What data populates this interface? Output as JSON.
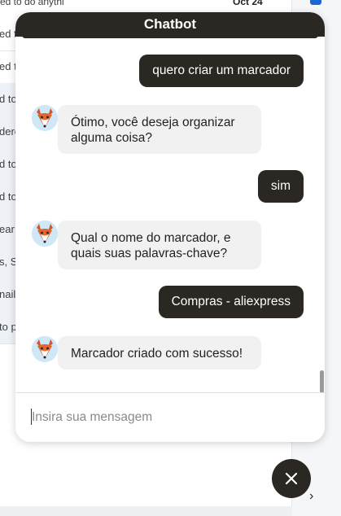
{
  "background": {
    "first_row": {
      "snippet": "ed to do anythi",
      "date": "Oct 24"
    },
    "rows": [
      {
        "text": "ed t",
        "shaded": false
      },
      {
        "text": "ed t",
        "shaded": false
      },
      {
        "text": "d to",
        "shaded": true
      },
      {
        "text": "dere",
        "shaded": true
      },
      {
        "text": "d to",
        "shaded": true
      },
      {
        "text": "d to",
        "shaded": true
      },
      {
        "text": "ear",
        "shaded": true
      },
      {
        "text": "s, S",
        "shaded": true
      },
      {
        "text": "nail",
        "shaded": true
      },
      {
        "text": "to p",
        "shaded": true
      }
    ]
  },
  "chat": {
    "title": "Chatbot",
    "messages": [
      {
        "role": "user",
        "text": "quero criar um marcador"
      },
      {
        "role": "bot",
        "text": "Ótimo, você deseja organizar alguma coisa?"
      },
      {
        "role": "user",
        "text": "sim"
      },
      {
        "role": "bot",
        "text": "Qual o nome do marcador, e quais suas palavras-chave?"
      },
      {
        "role": "user",
        "text": "Compras - aliexpress"
      },
      {
        "role": "bot",
        "text": "Marcador criado com sucesso!"
      }
    ],
    "input": {
      "placeholder": "Insira sua mensagem",
      "value": ""
    }
  },
  "icons": {
    "avatar": "fox-avatar-icon",
    "close": "close-icon",
    "rail": "chevron-right-icon"
  },
  "colors": {
    "header_bg": "#2b2823",
    "user_bubble": "#2b2823",
    "bot_bubble": "#f1f1f1",
    "avatar_bg": "#cfe8f7"
  }
}
